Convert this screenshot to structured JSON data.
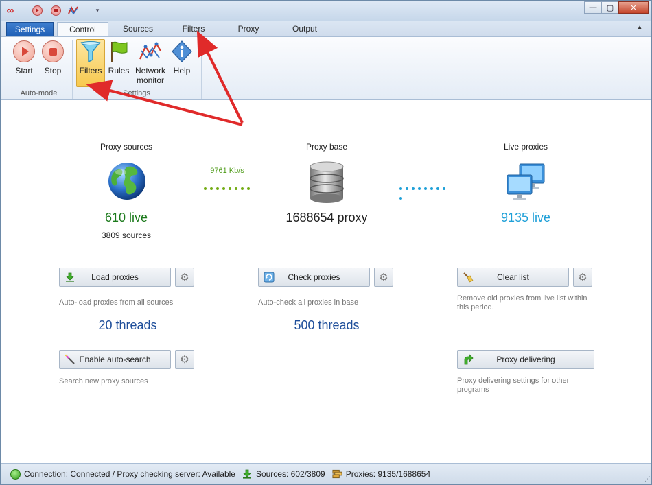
{
  "titlebar": {
    "logo": "∞",
    "window_controls": {
      "minimize": "—",
      "maximize": "▢",
      "close": "✕"
    }
  },
  "tabs": [
    {
      "label": "Settings"
    },
    {
      "label": "Control"
    },
    {
      "label": "Sources"
    },
    {
      "label": "Filters"
    },
    {
      "label": "Proxy"
    },
    {
      "label": "Output"
    }
  ],
  "ribbon": {
    "start": "Start",
    "stop": "Stop",
    "filters": "Filters",
    "rules": "Rules",
    "network_monitor_line1": "Network",
    "network_monitor_line2": "monitor",
    "help": "Help",
    "group_automode": "Auto-mode",
    "group_settings": "Settings"
  },
  "overview": {
    "sources_title": "Proxy sources",
    "sources_live": "610 live",
    "sources_count": "3809 sources",
    "speed": "9761 Kb/s",
    "base_title": "Proxy base",
    "base_count": "1688654 proxy",
    "live_title": "Live proxies",
    "live_count": "9135 live"
  },
  "actions": {
    "load_proxies": "Load proxies",
    "load_desc": "Auto-load proxies from all sources",
    "load_threads": "20 threads",
    "check_proxies": "Check proxies",
    "check_desc": "Auto-check all proxies in base",
    "check_threads": "500 threads",
    "clear_list": "Clear list",
    "clear_desc": "Remove old proxies from live list within this period.",
    "auto_search": "Enable auto-search",
    "search_desc": "Search new proxy sources",
    "proxy_delivering": "Proxy delivering",
    "delivering_desc": "Proxy delivering settings for other programs"
  },
  "status": {
    "connection": "Connection: Connected / Proxy checking server: Available",
    "sources": "Sources: 602/3809",
    "proxies": "Proxies: 9135/1688654"
  },
  "colors": {
    "accent_blue": "#1f5fb5",
    "live_green": "#1c7a1c",
    "live_blue": "#1fa0d8",
    "threads_blue": "#1e4e9a",
    "annotation_red": "#e02a2a"
  }
}
